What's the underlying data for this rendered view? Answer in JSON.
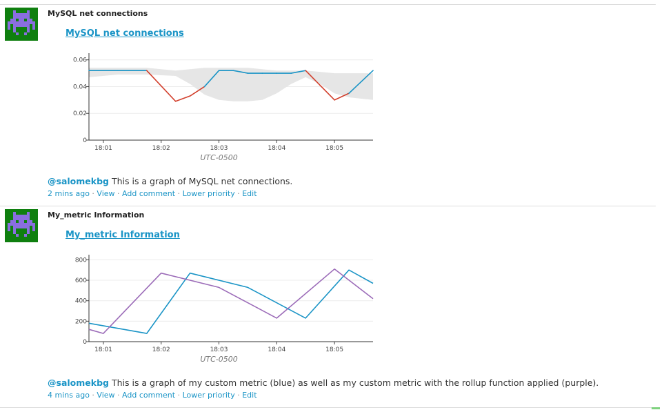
{
  "events": [
    {
      "title": "MySQL net connections",
      "graph_title": "MySQL net connections",
      "author": "@salomekbg",
      "text": "This is a graph of MySQL net connections.",
      "meta": {
        "time": "2 mins ago",
        "view": "View",
        "add_comment": "Add comment",
        "lower_priority": "Lower priority",
        "edit": "Edit"
      },
      "chart_data": {
        "type": "line",
        "x_ticks": [
          "18:01",
          "18:02",
          "18:03",
          "18:04",
          "18:05"
        ],
        "x_range": [
          "18:00:45",
          "18:05:40"
        ],
        "xlabel": "UTC-0500",
        "y_ticks": [
          "0",
          "0.02",
          "0.04",
          "0.06"
        ],
        "ylim": [
          0,
          0.065
        ],
        "series": [
          {
            "color": "#1a94c6",
            "anomaly_color": "#d23f2c",
            "x": [
              "18:00:45",
              "18:01:15",
              "18:01:45",
              "18:02:15",
              "18:02:30",
              "18:02:45",
              "18:03:00",
              "18:03:15",
              "18:03:30",
              "18:03:45",
              "18:04:00",
              "18:04:15",
              "18:04:30",
              "18:04:45",
              "18:05:00",
              "18:05:15",
              "18:05:40"
            ],
            "values": [
              0.052,
              0.052,
              0.052,
              0.029,
              0.033,
              0.04,
              0.052,
              0.052,
              0.05,
              0.05,
              0.05,
              0.05,
              0.052,
              0.041,
              0.03,
              0.035,
              0.052
            ]
          }
        ],
        "band": {
          "color": "#e6e6e6",
          "x": [
            "18:00:45",
            "18:01:15",
            "18:01:45",
            "18:02:15",
            "18:02:30",
            "18:02:45",
            "18:03:00",
            "18:03:15",
            "18:03:30",
            "18:03:45",
            "18:04:00",
            "18:04:15",
            "18:04:30",
            "18:04:45",
            "18:05:00",
            "18:05:15",
            "18:05:40"
          ],
          "upper": [
            0.054,
            0.054,
            0.054,
            0.052,
            0.053,
            0.054,
            0.054,
            0.054,
            0.054,
            0.053,
            0.052,
            0.052,
            0.052,
            0.051,
            0.05,
            0.05,
            0.05
          ],
          "lower": [
            0.047,
            0.049,
            0.049,
            0.048,
            0.042,
            0.034,
            0.03,
            0.029,
            0.029,
            0.03,
            0.035,
            0.042,
            0.047,
            0.042,
            0.035,
            0.032,
            0.03
          ]
        }
      }
    },
    {
      "title": "My_metric Information",
      "graph_title": "My_metric Information",
      "author": "@salomekbg",
      "text": "This is a graph of my custom metric (blue) as well as my custom metric with the rollup function applied (purple).",
      "meta": {
        "time": "4 mins ago",
        "view": "View",
        "add_comment": "Add comment",
        "lower_priority": "Lower priority",
        "edit": "Edit"
      },
      "chart_data": {
        "type": "line",
        "x_ticks": [
          "18:01",
          "18:02",
          "18:03",
          "18:04",
          "18:05"
        ],
        "x_range": [
          "18:00:45",
          "18:05:40"
        ],
        "xlabel": "UTC-0500",
        "y_ticks": [
          "0",
          "200",
          "400",
          "600",
          "800"
        ],
        "ylim": [
          0,
          850
        ],
        "series": [
          {
            "color": "#1a94c6",
            "x": [
              "18:00:45",
              "18:01:45",
              "18:02:30",
              "18:03:30",
              "18:04:30",
              "18:05:15",
              "18:05:40"
            ],
            "values": [
              180,
              80,
              670,
              530,
              230,
              700,
              570
            ]
          },
          {
            "color": "#9b6bb8",
            "x": [
              "18:00:45",
              "18:01:00",
              "18:02:00",
              "18:03:00",
              "18:04:00",
              "18:05:00",
              "18:05:40"
            ],
            "values": [
              120,
              80,
              670,
              530,
              230,
              710,
              420
            ]
          }
        ]
      }
    }
  ]
}
